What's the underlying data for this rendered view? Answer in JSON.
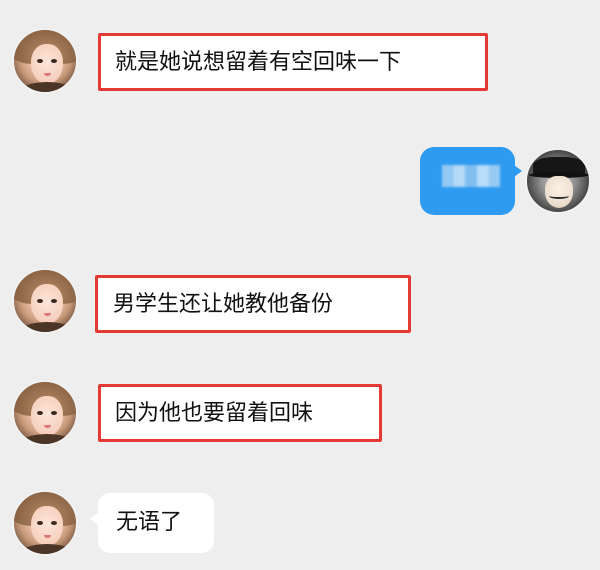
{
  "chat": {
    "messages": [
      {
        "side": "left",
        "text": "就是她说想留着有空回味一下",
        "highlighted": true
      },
      {
        "side": "right",
        "text": "",
        "blurred": true
      },
      {
        "side": "left",
        "text": "男学生还让她教他备份",
        "highlighted": true
      },
      {
        "side": "left",
        "text": "因为他也要留着回味",
        "highlighted": true
      },
      {
        "side": "left",
        "text": "无语了",
        "highlighted": false
      }
    ]
  },
  "colors": {
    "background": "#eeeeee",
    "bubble_incoming": "#ffffff",
    "bubble_outgoing": "#2f9bf0",
    "highlight_border": "#e53935"
  },
  "icons": {
    "incoming_avatar": "girl-avatar-icon",
    "outgoing_avatar": "masked-man-avatar-icon"
  }
}
